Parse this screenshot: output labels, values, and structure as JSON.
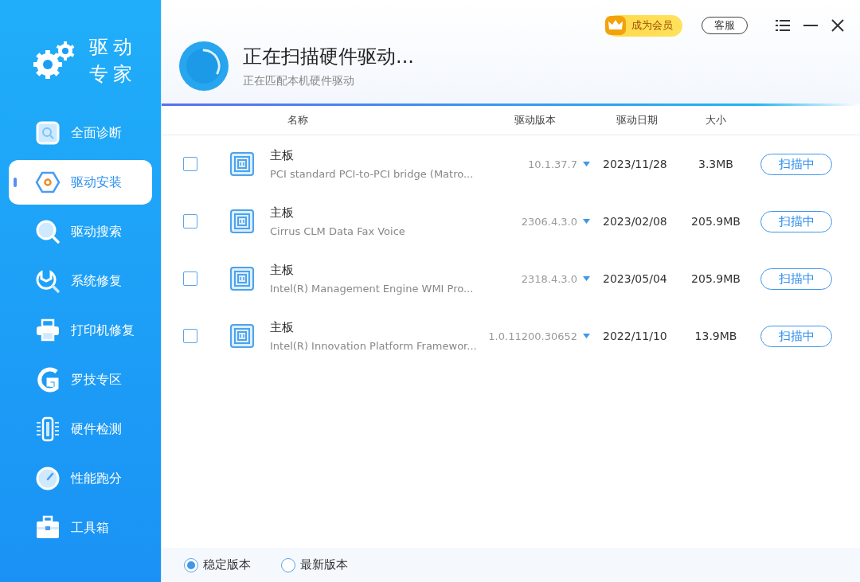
{
  "app": {
    "title_lines": [
      "驱动",
      "专家"
    ]
  },
  "sidebar": {
    "items": [
      {
        "label": "全面诊断",
        "selected": false
      },
      {
        "label": "驱动安装",
        "selected": true
      },
      {
        "label": "驱动搜索",
        "selected": false
      },
      {
        "label": "系统修复",
        "selected": false
      },
      {
        "label": "打印机修复",
        "selected": false
      },
      {
        "label": "罗技专区",
        "selected": false
      },
      {
        "label": "硬件检测",
        "selected": false
      },
      {
        "label": "性能跑分",
        "selected": false
      },
      {
        "label": "工具箱",
        "selected": false
      }
    ]
  },
  "header": {
    "member_button": "成为会员",
    "service_button": "客服",
    "title": "正在扫描硬件驱动...",
    "subtitle": "正在匹配本机硬件驱动"
  },
  "table": {
    "columns": [
      "名称",
      "驱动版本",
      "驱动日期",
      "大小"
    ],
    "rows": [
      {
        "checked": false,
        "category": "主板",
        "name": "PCI standard PCI-to-PCI bridge (Matro...",
        "version": "10.1.37.7",
        "date": "2023/11/28",
        "size": "3.3MB",
        "action": "扫描中"
      },
      {
        "checked": false,
        "category": "主板",
        "name": "Cirrus CLM Data Fax Voice",
        "version": "2306.4.3.0",
        "date": "2023/02/08",
        "size": "205.9MB",
        "action": "扫描中"
      },
      {
        "checked": false,
        "category": "主板",
        "name": "Intel(R) Management Engine WMI Pro...",
        "version": "2318.4.3.0",
        "date": "2023/05/04",
        "size": "205.9MB",
        "action": "扫描中"
      },
      {
        "checked": false,
        "category": "主板",
        "name": "Intel(R) Innovation Platform Framewor...",
        "version": "1.0.11200.30652",
        "date": "2022/11/10",
        "size": "13.9MB",
        "action": "扫描中"
      }
    ]
  },
  "footer": {
    "options": [
      {
        "label": "稳定版本",
        "selected": true
      },
      {
        "label": "最新版本",
        "selected": false
      }
    ]
  }
}
